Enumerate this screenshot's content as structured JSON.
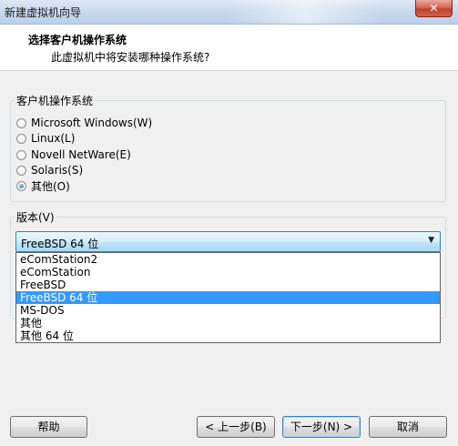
{
  "window": {
    "title": "新建虚拟机向导",
    "close_glyph": "✕"
  },
  "header": {
    "title": "选择客户机操作系统",
    "subtitle": "此虚拟机中将安装哪种操作系统?"
  },
  "guest_os": {
    "legend": "客户机操作系统",
    "options": [
      {
        "label": "Microsoft Windows(W)",
        "checked": false
      },
      {
        "label": "Linux(L)",
        "checked": false
      },
      {
        "label": "Novell NetWare(E)",
        "checked": false
      },
      {
        "label": "Solaris(S)",
        "checked": false
      },
      {
        "label": "其他(O)",
        "checked": true
      }
    ]
  },
  "version": {
    "legend": "版本(V)",
    "selected": "FreeBSD 64 位",
    "arrow_icon": "chevron-down-icon",
    "options": [
      "eComStation2",
      "eComStation",
      "FreeBSD",
      "FreeBSD 64 位",
      "MS-DOS",
      "其他",
      "其他 64 位"
    ],
    "highlighted_index": 3
  },
  "buttons": {
    "help": "帮助",
    "back": "< 上一步(B)",
    "next": "下一步(N) >",
    "cancel": "取消"
  }
}
